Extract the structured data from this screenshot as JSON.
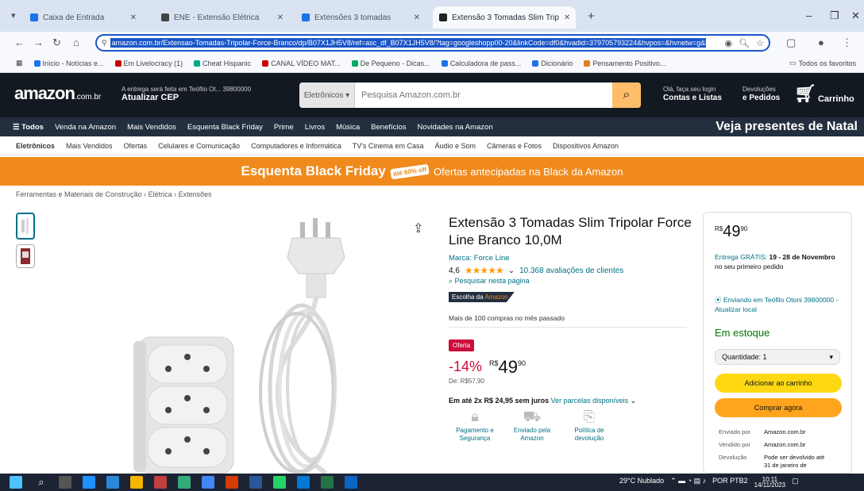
{
  "browser": {
    "tabs": [
      {
        "label": "Caixa de Entrada",
        "color": "#1a73e8"
      },
      {
        "label": "ENE - Extensão Elétrica",
        "color": "#444444"
      },
      {
        "label": "Extensões 3 tomadas",
        "color": "#1a73e8"
      },
      {
        "label": "Extensão 3 Tomadas Slim Trip",
        "color": "#222222"
      }
    ],
    "url": "amazon.com.br/Extensao-Tomadas-Tripolar-Force-Branco/dp/B07X1JH5V8/ref=asc_df_B07X1JH5V8/?tag=googleshopp00-20&linkCode=df0&hvadid=379705793224&hvpos=&hvnetw=g&hvrand",
    "bookmarks": [
      "Início - Notícias e...",
      "Em Livelocracy (1)",
      "Cheat Hispanic",
      "CANAL VÍDEO MAT...",
      "De Pequeno - Dicas...",
      "Calculadora de pass...",
      "Dicionário",
      "Pensamento Positivo..."
    ],
    "bookmark_right": "Todos os favoritos"
  },
  "amazon": {
    "logo": "amazon",
    "logo_suffix": ".com.br",
    "deliver_line1": "A entrega será feita em Teófilo Ot... 39800000",
    "deliver_line2": "Atualizar CEP",
    "search_category": "Eletrônicos",
    "search_placeholder": "Pesquisa Amazon.com.br",
    "account_line1": "Olá, faça seu login",
    "account_line2": "Contas e Listas",
    "returns_line1": "Devoluções",
    "returns_line2": "e Pedidos",
    "cart": "Carrinho",
    "nav": [
      "Todos",
      "Venda na Amazon",
      "Mais Vendidos",
      "Esquenta Black Friday",
      "Prime",
      "Livros",
      "Música",
      "Benefícios",
      "Novidades na Amazon"
    ],
    "nav_promo": "Veja presentes de Natal",
    "subnav": [
      "Eletrônicos",
      "Mais Vendidos",
      "Ofertas",
      "Celulares e Comunicação",
      "Computadores e Informática",
      "TV's Cinema em Casa",
      "Áudio e Som",
      "Câmeras e Fotos",
      "Dispositivos Amazon"
    ],
    "banner_title": "Esquenta Black Friday",
    "banner_badge": "até 60% off",
    "banner_text": "Ofertas antecipadas na Black da Amazon",
    "breadcrumb": "Ferramentas e Materiais de Construção › Elétrica › Extensões"
  },
  "product": {
    "title": "Extensão 3 Tomadas Slim Tripolar Force Line Branco 10,0M",
    "brand": "Marca: Force Line",
    "rating": "4,6",
    "stars": "★★★★★",
    "reviews": "10.368 avaliações de clientes",
    "search_page": "Pesquisar nesta página",
    "popular_prefix": "Escolha da",
    "popular_suffix": "Amazon",
    "bought": "Mais de 100 compras no mês passado",
    "offer_badge": "Oferta",
    "discount": "-14%",
    "price_currency": "R$",
    "price_int": "49",
    "price_dec": "90",
    "list_price": "De: R$57,90",
    "installments_bold": "Em até 2x R$ 24,95 sem juros",
    "installments_link": "Ver parcelas disponíveis",
    "features": [
      {
        "icon": "payment",
        "label": "Pagamento e Segurança"
      },
      {
        "icon": "shipping",
        "label": "Enviado pela Amazon"
      },
      {
        "icon": "returns",
        "label": "Política de devolução"
      }
    ]
  },
  "buybox": {
    "currency": "R$",
    "price_int": "49",
    "price_dec": "90",
    "delivery_prefix": "Entrega GRÁTIS:",
    "delivery_dates": "19 - 28 de Novembro",
    "delivery_suffix": "no seu primeiro pedido",
    "location": "Enviando em Teófilo Otoni 39800000 - Atualizar local",
    "stock": "Em estoque",
    "qty_label": "Quantidade: 1",
    "add_to_cart": "Adicionar ao carrinho",
    "buy_now": "Comprar agora",
    "ship_from_label": "Enviado por",
    "ship_from": "Amazon.com.br",
    "sold_by_label": "Vendido por",
    "sold_by": "Amazon.com.br",
    "returns_label": "Devolução",
    "returns": "Pode ser devolvido até 31 de janeiro de"
  },
  "taskbar": {
    "weather": "29°C Nublado",
    "time": "10:11",
    "date": "14/11/2023",
    "lang": "POR PTB2"
  }
}
